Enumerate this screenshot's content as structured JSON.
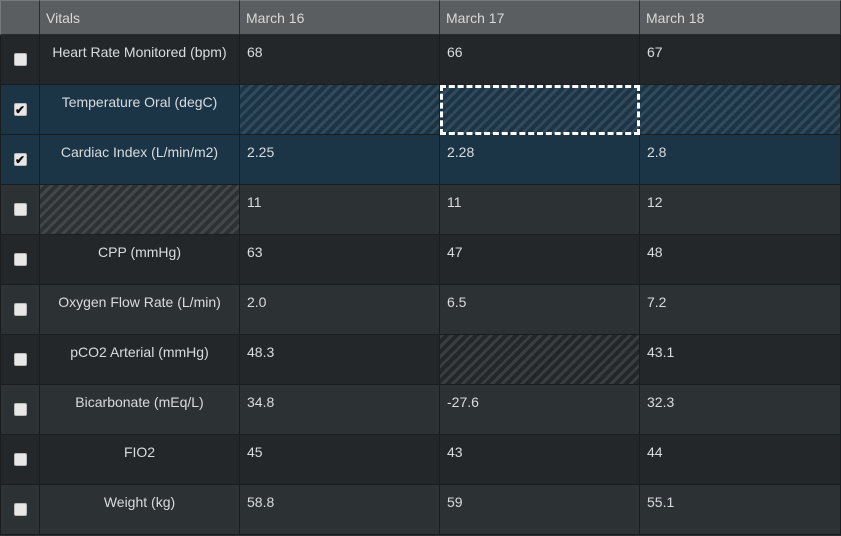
{
  "table": {
    "headers": [
      "",
      "Vitals",
      "March 16",
      "March 17",
      "March 18"
    ],
    "rows": [
      {
        "checked": false,
        "label": "Heart Rate Monitored (bpm)",
        "values": [
          "68",
          "66",
          "67"
        ],
        "hatched": [],
        "selected": false
      },
      {
        "checked": true,
        "label": "Temperature Oral (degC)",
        "values": [
          "",
          "",
          ""
        ],
        "hatched": [
          1,
          2,
          3
        ],
        "selected": true,
        "focused_col": 2
      },
      {
        "checked": true,
        "label": "Cardiac Index (L/min/m2)",
        "values": [
          "2.25",
          "2.28",
          "2.8"
        ],
        "hatched": [],
        "selected": true
      },
      {
        "checked": false,
        "label": "",
        "values": [
          "11",
          "11",
          "12"
        ],
        "hatched": [
          0
        ],
        "selected": false
      },
      {
        "checked": false,
        "label": "CPP (mmHg)",
        "values": [
          "63",
          "47",
          "48"
        ],
        "hatched": [],
        "selected": false
      },
      {
        "checked": false,
        "label": "Oxygen Flow Rate (L/min)",
        "values": [
          "2.0",
          "6.5",
          "7.2"
        ],
        "hatched": [],
        "selected": false
      },
      {
        "checked": false,
        "label": "pCO2 Arterial (mmHg)",
        "values": [
          "48.3",
          "",
          "43.1"
        ],
        "hatched": [
          2
        ],
        "selected": false
      },
      {
        "checked": false,
        "label": "Bicarbonate (mEq/L)",
        "values": [
          "34.8",
          "-27.6",
          "32.3"
        ],
        "hatched": [],
        "selected": false
      },
      {
        "checked": false,
        "label": "FIO2",
        "values": [
          "45",
          "43",
          "44"
        ],
        "hatched": [],
        "selected": false
      },
      {
        "checked": false,
        "label": "Weight (kg)",
        "values": [
          "58.8",
          "59",
          "55.1"
        ],
        "hatched": [],
        "selected": false
      }
    ]
  }
}
